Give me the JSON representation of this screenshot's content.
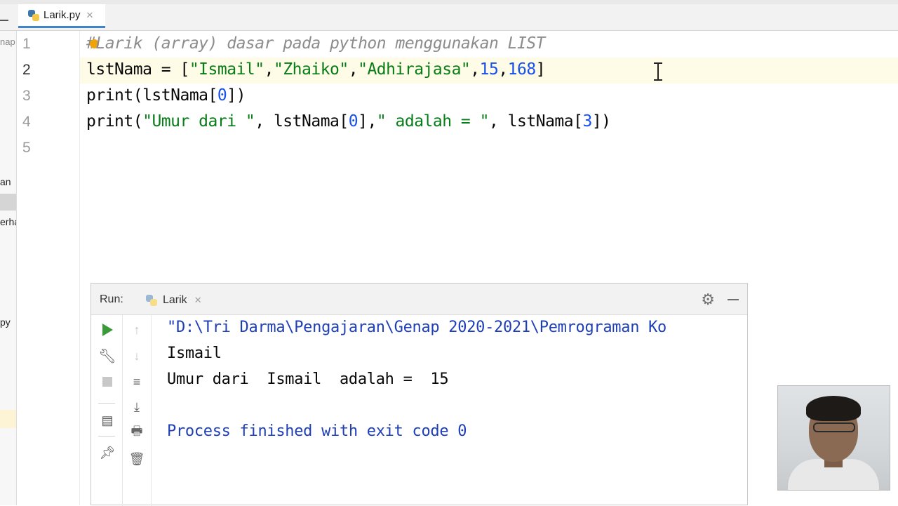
{
  "editor_tab": {
    "filename": "Larik.py",
    "close": "✕"
  },
  "project_panel": {
    "frag1": "nap",
    "frag2": "an",
    "frag3": "erha",
    "frag4": "py"
  },
  "line_numbers": [
    "1",
    "2",
    "3",
    "4",
    "5"
  ],
  "code": {
    "line1": {
      "hash": "#",
      "comment": "Larik (array) dasar pada python menggunakan LIST"
    },
    "line2": {
      "p1": "lstNama = [",
      "s1": "\"Ismail\"",
      "c1": ",",
      "s2": "\"Zhaiko\"",
      "c2": ",",
      "s3": "\"Adhirajasa\"",
      "c3": ",",
      "n1": "15",
      "c4": ",",
      "n2": "168",
      "p2": "]"
    },
    "line3": {
      "p1": "print(lstNama[",
      "n1": "0",
      "p2": "])"
    },
    "line4": {
      "p1": "print(",
      "s1": "\"Umur dari \"",
      "p2": ", lstNama[",
      "n1": "0",
      "p3": "],",
      "s2": "\" adalah = \"",
      "p4": ", lstNama[",
      "n2": "3",
      "p5": "])"
    }
  },
  "run_window": {
    "label": "Run:",
    "tab_name": "Larik",
    "tab_close": "✕",
    "gear": "⚙",
    "console": {
      "line1": "\"D:\\Tri Darma\\Pengajaran\\Genap 2020-2021\\Pemrograman Ko",
      "line2": "Ismail",
      "line3": "Umur dari  Ismail  adalah =  15",
      "line4": "Process finished with exit code 0"
    }
  },
  "colors": {
    "string": "#067d17",
    "number": "#1750eb",
    "comment": "#8c8c8c",
    "process": "#1f3fb8",
    "run_green": "#3c9a3c"
  }
}
